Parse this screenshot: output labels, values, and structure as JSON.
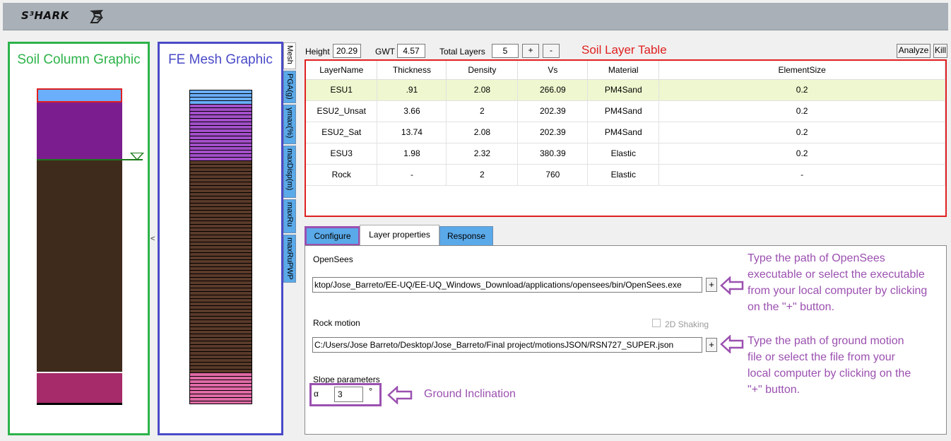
{
  "header": {
    "brand": "S³HARK",
    "logo_icon": "shark-logo-icon"
  },
  "panels": {
    "soil_column_title": "Soil Column Graphic",
    "fe_mesh_title": "FE Mesh Graphic",
    "collapse_glyph": "<"
  },
  "colors": {
    "soil_layers": [
      "#6aaefc",
      "#7c1d8f",
      "#3f2b1c",
      "#a62b6a"
    ],
    "mesh_lines": [
      "#6aaefc",
      "#a34fc9",
      "#5a3a2a",
      "#e06aa6"
    ],
    "annotation_red": "#e02020",
    "annotation_purple": "#9b50b0",
    "soil_box_green": "#2db34a",
    "mesh_box_blue": "#4a4ac8"
  },
  "vertical_tabs": [
    {
      "label": "Mesh",
      "active": true
    },
    {
      "label": "PGA(g)",
      "active": false
    },
    {
      "label": "γmax(%)",
      "active": false
    },
    {
      "label": "maxDisp(m)",
      "active": false
    },
    {
      "label": "maxRu",
      "active": false
    },
    {
      "label": "maxRuPWP",
      "active": false
    }
  ],
  "controls": {
    "height_label": "Height",
    "height_value": "20.29",
    "gwt_label": "GWT",
    "gwt_value": "4.57",
    "total_layers_label": "Total Layers",
    "total_layers_value": "5",
    "plus": "+",
    "minus": "-",
    "analyze": "Analyze",
    "kill": "Kill"
  },
  "annotations": {
    "soil_layer_table": "Soil Layer Table",
    "opensees_note": [
      "Type the path of OpenSees",
      "executable or select the executable",
      "from your local computer by clicking",
      "on the \"+\" button."
    ],
    "motion_note": [
      "Type the path of ground motion",
      "file or select the file from your",
      "local computer by clicking on the",
      "\"+\" button."
    ],
    "inclination_note": "Ground Inclination"
  },
  "table": {
    "headers": [
      "LayerName",
      "Thickness",
      "Density",
      "Vs",
      "Material",
      "ElementSize"
    ],
    "rows": [
      [
        "ESU1",
        ".91",
        "2.08",
        "266.09",
        "PM4Sand",
        "0.2"
      ],
      [
        "ESU2_Unsat",
        "3.66",
        "2",
        "202.39",
        "PM4Sand",
        "0.2"
      ],
      [
        "ESU2_Sat",
        "13.74",
        "2.08",
        "202.39",
        "PM4Sand",
        "0.2"
      ],
      [
        "ESU3",
        "1.98",
        "2.32",
        "380.39",
        "Elastic",
        "0.2"
      ],
      [
        "Rock",
        "-",
        "2",
        "760",
        "Elastic",
        "-"
      ]
    ],
    "selected_row": 0
  },
  "tabs": {
    "configure": "Configure",
    "layer_properties": "Layer properties",
    "response": "Response"
  },
  "config": {
    "opensees_label": "OpenSees",
    "opensees_path": "ktop/Jose_Barreto/EE-UQ/EE-UQ_Windows_Download/applications/opensees/bin/OpenSees.exe",
    "rock_motion_label": "Rock motion",
    "shaking_2d_label": "2D Shaking",
    "rock_motion_path": "C:/Users/Jose Barreto/Desktop/Jose_Barreto/Final project/motionsJSON/RSN727_SUPER.json",
    "slope_label": "Slope parameters",
    "alpha_symbol": "α",
    "slope_value": "3",
    "degree_symbol": "°",
    "plus": "+"
  }
}
